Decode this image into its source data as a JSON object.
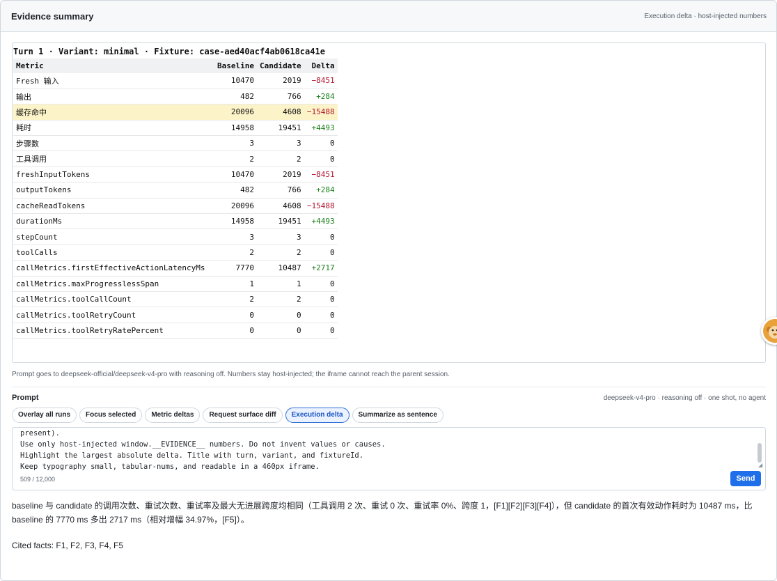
{
  "header": {
    "title": "Evidence summary",
    "meta": "Execution delta · host-injected numbers"
  },
  "evidence": {
    "table_title": "Turn 1 · Variant: minimal · Fixture: case-aed40acf4ab0618ca41e",
    "columns": [
      "Metric",
      "Baseline",
      "Candidate",
      "Delta"
    ],
    "rows": [
      {
        "metric": "Fresh 输入",
        "baseline": "10470",
        "candidate": "2019",
        "delta": "−8451",
        "sign": "neg"
      },
      {
        "metric": "输出",
        "baseline": "482",
        "candidate": "766",
        "delta": "+284",
        "sign": "pos"
      },
      {
        "metric": "缓存命中",
        "baseline": "20096",
        "candidate": "4608",
        "delta": "−15488",
        "sign": "neg",
        "highlight": true
      },
      {
        "metric": "耗时",
        "baseline": "14958",
        "candidate": "19451",
        "delta": "+4493",
        "sign": "pos"
      },
      {
        "metric": "步骤数",
        "baseline": "3",
        "candidate": "3",
        "delta": "0",
        "sign": "zero"
      },
      {
        "metric": "工具调用",
        "baseline": "2",
        "candidate": "2",
        "delta": "0",
        "sign": "zero"
      },
      {
        "metric": "freshInputTokens",
        "baseline": "10470",
        "candidate": "2019",
        "delta": "−8451",
        "sign": "neg"
      },
      {
        "metric": "outputTokens",
        "baseline": "482",
        "candidate": "766",
        "delta": "+284",
        "sign": "pos"
      },
      {
        "metric": "cacheReadTokens",
        "baseline": "20096",
        "candidate": "4608",
        "delta": "−15488",
        "sign": "neg"
      },
      {
        "metric": "durationMs",
        "baseline": "14958",
        "candidate": "19451",
        "delta": "+4493",
        "sign": "pos"
      },
      {
        "metric": "stepCount",
        "baseline": "3",
        "candidate": "3",
        "delta": "0",
        "sign": "zero"
      },
      {
        "metric": "toolCalls",
        "baseline": "2",
        "candidate": "2",
        "delta": "0",
        "sign": "zero"
      },
      {
        "metric": "callMetrics.firstEffectiveActionLatencyMs",
        "baseline": "7770",
        "candidate": "10487",
        "delta": "+2717",
        "sign": "pos"
      },
      {
        "metric": "callMetrics.maxProgresslessSpan",
        "baseline": "1",
        "candidate": "1",
        "delta": "0",
        "sign": "zero"
      },
      {
        "metric": "callMetrics.toolCallCount",
        "baseline": "2",
        "candidate": "2",
        "delta": "0",
        "sign": "zero"
      },
      {
        "metric": "callMetrics.toolRetryCount",
        "baseline": "0",
        "candidate": "0",
        "delta": "0",
        "sign": "zero"
      },
      {
        "metric": "callMetrics.toolRetryRatePercent",
        "baseline": "0",
        "candidate": "0",
        "delta": "0",
        "sign": "zero"
      }
    ],
    "colors": {
      "negative": "#b0122b",
      "positive": "#1a7f1a",
      "highlight": "#fdf3c8"
    }
  },
  "note": "Prompt goes to deepseek-official/deepseek-v4-pro with reasoning off. Numbers stay host-injected; the iframe cannot reach the parent session.",
  "prompt": {
    "label": "Prompt",
    "meta": "deepseek-v4-pro · reasoning off · one shot, no agent",
    "chips": [
      {
        "label": "Overlay all runs",
        "active": false
      },
      {
        "label": "Focus selected",
        "active": false
      },
      {
        "label": "Metric deltas",
        "active": false
      },
      {
        "label": "Request surface diff",
        "active": false
      },
      {
        "label": "Execution delta",
        "active": true
      },
      {
        "label": "Summarize as sentence",
        "active": false
      }
    ],
    "text_lines": [
      "present).",
      "Use only host-injected window.__EVIDENCE__ numbers. Do not invent values or causes.",
      "Highlight the largest absolute delta. Title with turn, variant, and fixtureId.",
      "Keep typography small, tabular-nums, and readable in a 460px iframe."
    ],
    "counter": "509 / 12,000",
    "send_label": "Send",
    "accent": "#1f6feb"
  },
  "answer": {
    "text": "baseline 与 candidate 的调用次数、重试次数、重试率及最大无进展跨度均相同（工具调用 2 次、重试 0 次、重试率 0%、跨度 1，[F1][F2][F3][F4]），但 candidate 的首次有效动作耗时为 10487 ms，比 baseline 的 7770 ms 多出 2717 ms（相对增幅 34.97%，[F5]）。",
    "cited": "Cited facts: F1, F2, F3, F4, F5"
  },
  "avatar": {
    "icon": "monkey-avatar-icon"
  }
}
